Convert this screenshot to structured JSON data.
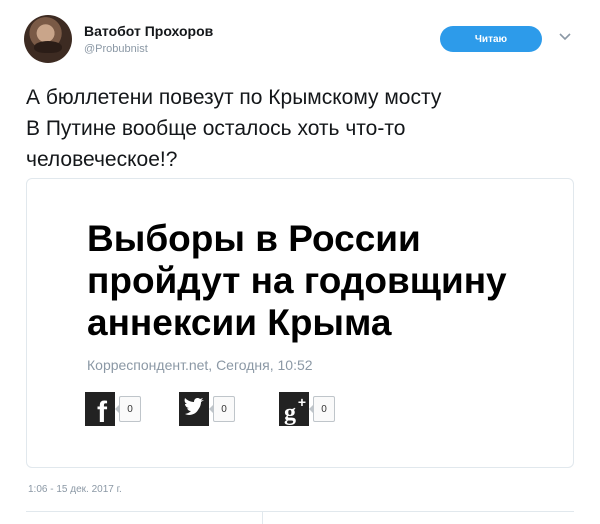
{
  "author": {
    "name": "Ватобот Прохоров",
    "handle": "@Probubnist"
  },
  "follow_button": {
    "label": "Читаю"
  },
  "tweet": {
    "lines": [
      "А бюллетени повезут по Крымскому мосту",
      "В Путине вообще осталось хоть что-то",
      "человеческое!?"
    ],
    "timestamp": "1:06 - 15 дек. 2017 г."
  },
  "card": {
    "headline_lines": [
      "Выборы в России",
      "пройдут на годовщину",
      "аннексии Крыма"
    ],
    "source": "Корреспондент.net, Сегодня, 10:52",
    "shares": [
      {
        "icon": "facebook-icon",
        "glyph": "f",
        "count": "0",
        "color": "#222222"
      },
      {
        "icon": "twitter-icon",
        "glyph": "t",
        "count": "0",
        "color": "#222222"
      },
      {
        "icon": "google-plus-icon",
        "glyph": "g+",
        "count": "0",
        "color": "#222222"
      }
    ]
  },
  "colors": {
    "accent": "#2d9bea",
    "muted": "#8b98a5",
    "border": "#e1e8ed"
  }
}
